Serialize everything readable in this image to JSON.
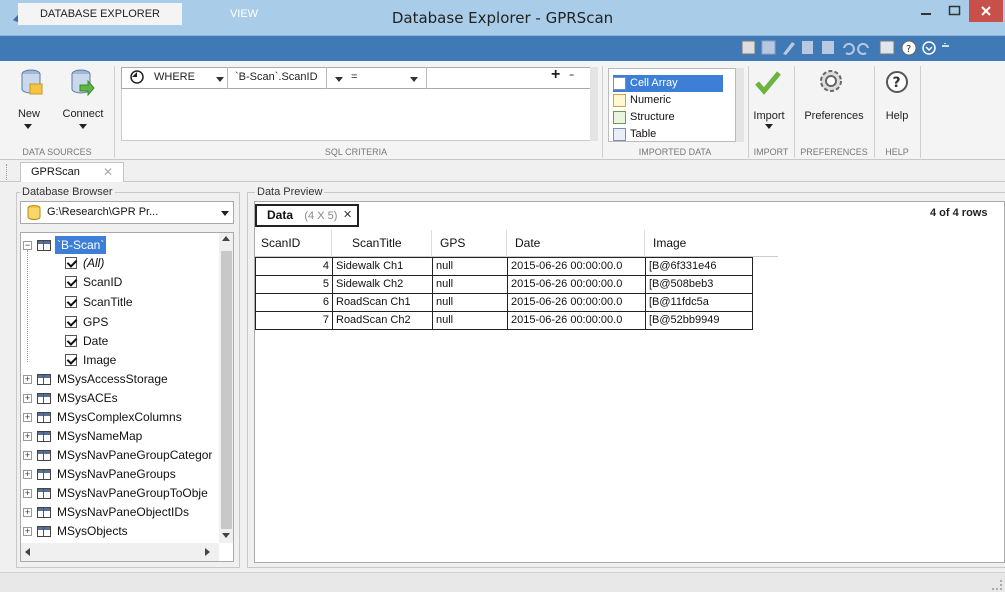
{
  "window": {
    "title": "Database Explorer - GPRScan"
  },
  "tabs": [
    {
      "label": "DATABASE EXPLORER"
    },
    {
      "label": "VIEW"
    }
  ],
  "ribbon": {
    "data_sources": {
      "new_label": "New",
      "connect_label": "Connect",
      "group_label": "DATA SOURCES"
    },
    "sql_criteria": {
      "clause": "WHERE",
      "field": "`B-Scan`.ScanID",
      "operator": "=",
      "value": "",
      "add_label": "+",
      "remove_label": "-",
      "group_label": "SQL CRITERIA"
    },
    "imported_data": {
      "types": [
        {
          "label": "Cell Array",
          "selected": true
        },
        {
          "label": "Numeric",
          "selected": false
        },
        {
          "label": "Structure",
          "selected": false
        },
        {
          "label": "Table",
          "selected": false
        }
      ],
      "group_label": "IMPORTED DATA"
    },
    "import": {
      "label": "Import",
      "group_label": "IMPORT"
    },
    "preferences": {
      "label": "Preferences",
      "group_label": "PREFERENCES"
    },
    "help": {
      "label": "Help",
      "group_label": "HELP"
    }
  },
  "doc_tab": {
    "label": "GPRScan"
  },
  "browser": {
    "title": "Database Browser",
    "source": "G:\\Research\\GPR Pr...",
    "tree": {
      "root": "`B-Scan`",
      "fields": [
        "(All)",
        "ScanID",
        "ScanTitle",
        "GPS",
        "Date",
        "Image"
      ],
      "tables": [
        "MSysAccessStorage",
        "MSysACEs",
        "MSysComplexColumns",
        "MSysNameMap",
        "MSysNavPaneGroupCategor",
        "MSysNavPaneGroups",
        "MSysNavPaneGroupToObje",
        "MSysNavPaneObjectIDs",
        "MSysObjects"
      ]
    }
  },
  "preview": {
    "title": "Data Preview",
    "tab_label": "Data",
    "tab_size": "(4 X 5)",
    "rows_label": "4 of 4 rows",
    "columns": [
      "ScanID",
      "ScanTitle",
      "GPS",
      "Date",
      "Image"
    ],
    "rows": [
      [
        "4",
        "Sidewalk Ch1",
        "null",
        "2015-06-26 00:00:00.0",
        "[B@6f331e46"
      ],
      [
        "5",
        "Sidewalk Ch2",
        "null",
        "2015-06-26 00:00:00.0",
        "[B@508beb3"
      ],
      [
        "6",
        "RoadScan Ch1",
        "null",
        "2015-06-26 00:00:00.0",
        "[B@11fdc5a"
      ],
      [
        "7",
        "RoadScan Ch2",
        "null",
        "2015-06-26 00:00:00.0",
        "[B@52bb9949"
      ]
    ]
  },
  "colors": {
    "title_bar": "#a9cde8",
    "tab_strip": "#3f79b6",
    "close_button": "#c7504b",
    "selection": "#3d7fd6"
  }
}
